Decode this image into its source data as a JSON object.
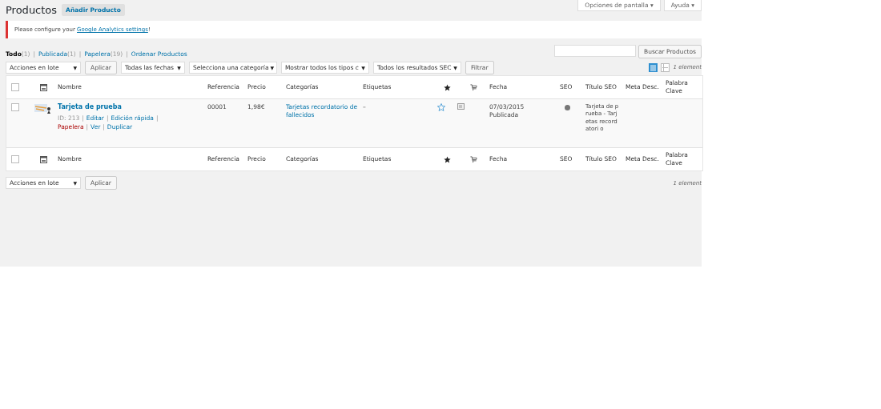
{
  "page_title": "Productos",
  "add_button": "Añadir Producto",
  "top_buttons": [
    "Opciones de pantalla ▾",
    "Ayuda ▾"
  ],
  "notice": {
    "text": "Please configure your ",
    "link": "Google Analytics settings",
    "after": "!"
  },
  "separator": "|",
  "caret": "▼",
  "views": [
    {
      "label": "Todo",
      "count": "(1)",
      "selected": true
    },
    {
      "label": "Publicada",
      "count": "(1)",
      "selected": false
    },
    {
      "label": "Papelera",
      "count": "(19)",
      "selected": false
    },
    {
      "label": "Ordenar Productos",
      "selected": false
    }
  ],
  "search": {
    "button": "Buscar Productos"
  },
  "filters": [
    "Acciones en lote",
    "Todas las fechas",
    "Selecciona una categoría",
    "Mostrar todos los tipos c",
    "Todos los resultados SEC"
  ],
  "apply_button": "Aplicar",
  "filter_button": "Filtrar",
  "view_modes": [
    {
      "kind": "list",
      "selected": true
    },
    {
      "kind": "excerpt",
      "selected": false
    }
  ],
  "count_text": "1 element",
  "header_checked": false,
  "footer_checked": false,
  "columns": [
    "Nombre",
    "Referencia",
    "Precio",
    "Categorías",
    "Etiquetas",
    "Fecha",
    "SEO",
    "Título SEO",
    "Meta Desc.",
    "Palabra Clave"
  ],
  "rows": [
    {
      "checked": false,
      "name": "Tarjeta de prueba",
      "id": "ID: 213",
      "actions": [
        {
          "label": "Editar",
          "kind": "link"
        },
        {
          "label": "Edición rápida",
          "kind": "link"
        },
        {
          "label": "Papelera",
          "kind": "trash"
        },
        {
          "label": "Ver",
          "kind": "link"
        },
        {
          "label": "Duplicar",
          "kind": "link"
        }
      ],
      "sku": "00001",
      "price": "1,98€",
      "categories": "Tarjetas recordatorio de fallecidos",
      "tags": "–",
      "featured": false,
      "date": "07/03/2015",
      "status": "Publicada",
      "color": "#777777",
      "seo_title": "Tarjeta de prueba - Tarjetas recordatori o"
    }
  ],
  "footer_columns": [
    "Nombre",
    "Referencia",
    "Precio",
    "Categorías",
    "Etiquetas",
    "Fecha",
    "SEO",
    "Título SEO",
    "Meta Desc.",
    "Palabra Clave"
  ],
  "bottom_bulk": "Acciones en lote",
  "bottom_apply": "Aplicar",
  "bottom_count": "1 element"
}
